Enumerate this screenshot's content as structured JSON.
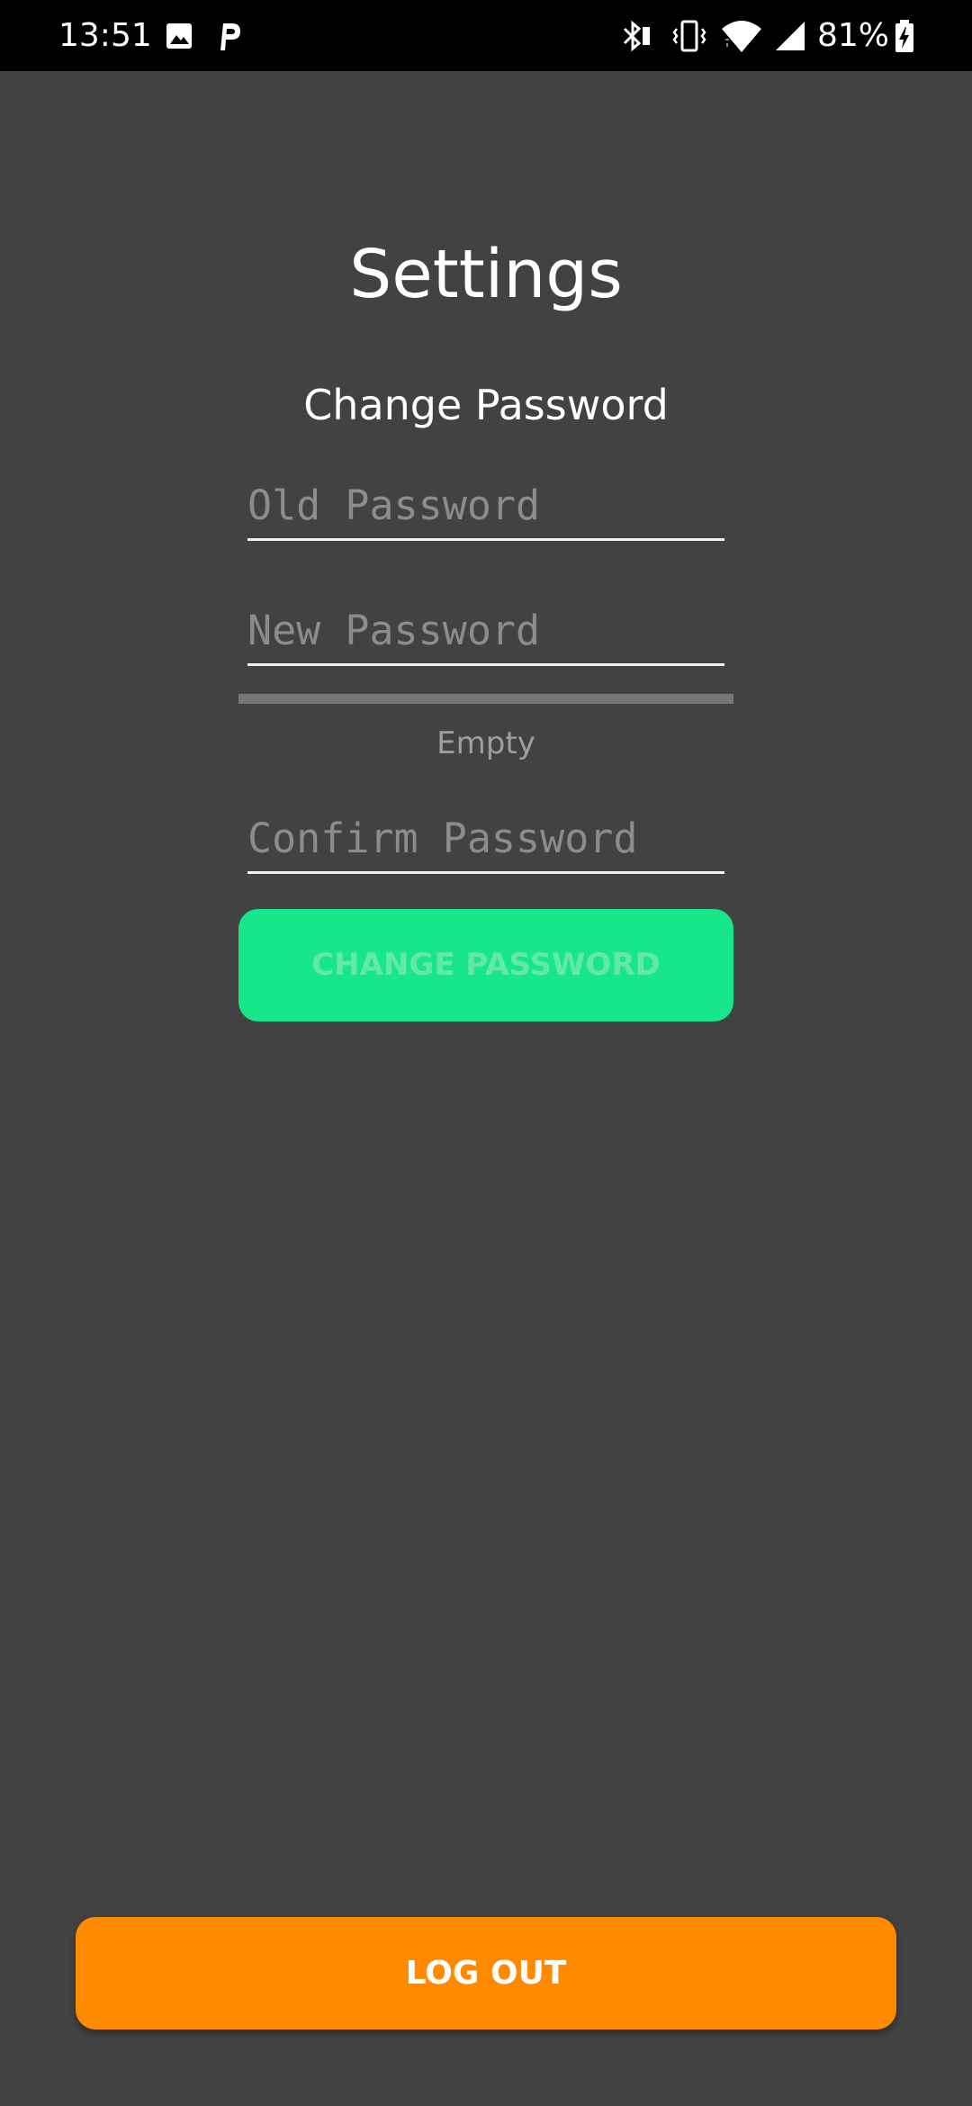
{
  "status_bar": {
    "time": "13:51",
    "battery_percent": "81%",
    "left_icons": [
      "gallery-icon",
      "parking-p-icon"
    ],
    "right_icons": [
      "bluetooth-icon",
      "vibrate-icon",
      "wifi-icon",
      "cell-signal-icon",
      "battery-charging-icon"
    ]
  },
  "page": {
    "title": "Settings",
    "section_title": "Change Password"
  },
  "form": {
    "old_password_placeholder": "Old Password",
    "new_password_placeholder": "New Password",
    "strength_label": "Empty",
    "confirm_password_placeholder": "Confirm Password",
    "change_button_label": "CHANGE PASSWORD"
  },
  "logout_button_label": "LOG OUT",
  "colors": {
    "background": "#424242",
    "change_button": "#17e68a",
    "logout_button": "#ff8a00"
  }
}
